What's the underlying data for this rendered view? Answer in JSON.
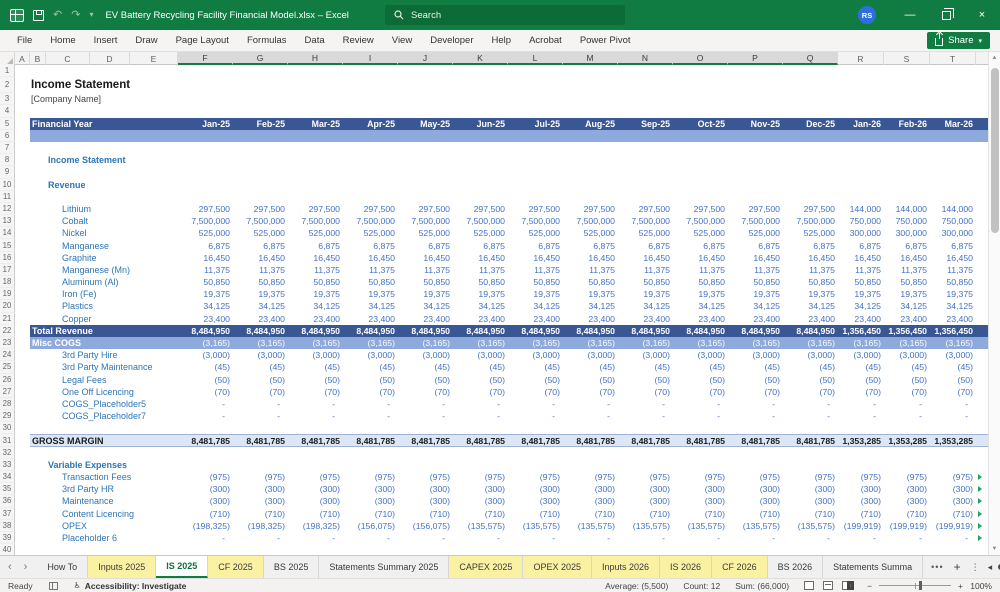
{
  "colors": {
    "titlebar_green": "#107C41",
    "search_green": "#0D6B37",
    "band_dark": "#3A5795",
    "band_light": "#8EA9DB",
    "gross_bg": "#DCE6F4",
    "label_blue": "#2E75B6",
    "value_blue": "#4472C4",
    "tab_yellow": "#FBF1A3",
    "avatar_blue": "#2D6FDF",
    "marker_green": "#21A366"
  },
  "icons": {
    "minimize": "—",
    "close": "×",
    "qat_dropdown": "▾",
    "undo": "↶",
    "redo": "↷",
    "share_dropdown": "▾",
    "tab_left": "‹",
    "tab_right": "›",
    "more_tabs": "•••",
    "add_sheet": "+",
    "sheet_list": "⋮",
    "hscroll_left": "◂",
    "hscroll_right": "▸",
    "vscroll_up": "▲",
    "vscroll_down": "▼",
    "zoom_out": "−",
    "zoom_in": "+",
    "accessibility": "♿"
  },
  "title_bar": {
    "title": "EV Battery Recycling Facility Financial Model.xlsx  –  Excel",
    "search_placeholder": "Search",
    "avatar_initials": "RS"
  },
  "ribbon": {
    "tabs": [
      "File",
      "Home",
      "Insert",
      "Draw",
      "Page Layout",
      "Formulas",
      "Data",
      "Review",
      "View",
      "Developer",
      "Help",
      "Acrobat",
      "Power Pivot"
    ],
    "share_label": "Share"
  },
  "grid": {
    "column_letters": [
      "A",
      "B",
      "C",
      "D",
      "E",
      "F",
      "G",
      "H",
      "I",
      "J",
      "K",
      "L",
      "M",
      "N",
      "O",
      "P",
      "Q",
      "R",
      "S",
      "T"
    ],
    "selected_column_range": [
      "F",
      "Q"
    ],
    "months": [
      "Jan-25",
      "Feb-25",
      "Mar-25",
      "Apr-25",
      "May-25",
      "Jun-25",
      "Jul-25",
      "Aug-25",
      "Sep-25",
      "Oct-25",
      "Nov-25",
      "Dec-25",
      "Jan-26",
      "Feb-26",
      "Mar-26"
    ],
    "rows": [
      {
        "n": 1,
        "type": "blank"
      },
      {
        "n": 2,
        "type": "doc-title",
        "label": "Income Statement"
      },
      {
        "n": 3,
        "type": "doc-subtitle",
        "label": "[Company Name]"
      },
      {
        "n": 4,
        "type": "blank"
      },
      {
        "n": 5,
        "type": "month-header",
        "label": "Financial Year"
      },
      {
        "n": 6,
        "type": "band"
      },
      {
        "n": 7,
        "type": "blank"
      },
      {
        "n": 8,
        "type": "section",
        "label": "Income Statement"
      },
      {
        "n": 9,
        "type": "blank"
      },
      {
        "n": 10,
        "type": "section",
        "label": "Revenue"
      },
      {
        "n": 11,
        "type": "blank"
      },
      {
        "n": 12,
        "type": "item",
        "label": "Lithium",
        "values": [
          "297,500",
          "297,500",
          "297,500",
          "297,500",
          "297,500",
          "297,500",
          "297,500",
          "297,500",
          "297,500",
          "297,500",
          "297,500",
          "297,500",
          "144,000",
          "144,000",
          "144,000"
        ]
      },
      {
        "n": 13,
        "type": "item",
        "label": "Cobalt",
        "values": [
          "7,500,000",
          "7,500,000",
          "7,500,000",
          "7,500,000",
          "7,500,000",
          "7,500,000",
          "7,500,000",
          "7,500,000",
          "7,500,000",
          "7,500,000",
          "7,500,000",
          "7,500,000",
          "750,000",
          "750,000",
          "750,000"
        ]
      },
      {
        "n": 14,
        "type": "item",
        "label": "Nickel",
        "values": [
          "525,000",
          "525,000",
          "525,000",
          "525,000",
          "525,000",
          "525,000",
          "525,000",
          "525,000",
          "525,000",
          "525,000",
          "525,000",
          "525,000",
          "300,000",
          "300,000",
          "300,000"
        ]
      },
      {
        "n": 15,
        "type": "item",
        "label": "Manganese",
        "values": [
          "6,875",
          "6,875",
          "6,875",
          "6,875",
          "6,875",
          "6,875",
          "6,875",
          "6,875",
          "6,875",
          "6,875",
          "6,875",
          "6,875",
          "6,875",
          "6,875",
          "6,875"
        ]
      },
      {
        "n": 16,
        "type": "item",
        "label": "Graphite",
        "values": [
          "16,450",
          "16,450",
          "16,450",
          "16,450",
          "16,450",
          "16,450",
          "16,450",
          "16,450",
          "16,450",
          "16,450",
          "16,450",
          "16,450",
          "16,450",
          "16,450",
          "16,450"
        ]
      },
      {
        "n": 17,
        "type": "item",
        "label": "Manganese (Mn)",
        "values": [
          "11,375",
          "11,375",
          "11,375",
          "11,375",
          "11,375",
          "11,375",
          "11,375",
          "11,375",
          "11,375",
          "11,375",
          "11,375",
          "11,375",
          "11,375",
          "11,375",
          "11,375"
        ]
      },
      {
        "n": 18,
        "type": "item",
        "label": "Aluminum (Al)",
        "values": [
          "50,850",
          "50,850",
          "50,850",
          "50,850",
          "50,850",
          "50,850",
          "50,850",
          "50,850",
          "50,850",
          "50,850",
          "50,850",
          "50,850",
          "50,850",
          "50,850",
          "50,850"
        ]
      },
      {
        "n": 19,
        "type": "item",
        "label": "Iron (Fe)",
        "values": [
          "19,375",
          "19,375",
          "19,375",
          "19,375",
          "19,375",
          "19,375",
          "19,375",
          "19,375",
          "19,375",
          "19,375",
          "19,375",
          "19,375",
          "19,375",
          "19,375",
          "19,375"
        ]
      },
      {
        "n": 20,
        "type": "item",
        "label": "Plastics",
        "values": [
          "34,125",
          "34,125",
          "34,125",
          "34,125",
          "34,125",
          "34,125",
          "34,125",
          "34,125",
          "34,125",
          "34,125",
          "34,125",
          "34,125",
          "34,125",
          "34,125",
          "34,125"
        ]
      },
      {
        "n": 21,
        "type": "item",
        "label": "Copper",
        "values": [
          "23,400",
          "23,400",
          "23,400",
          "23,400",
          "23,400",
          "23,400",
          "23,400",
          "23,400",
          "23,400",
          "23,400",
          "23,400",
          "23,400",
          "23,400",
          "23,400",
          "23,400"
        ]
      },
      {
        "n": 22,
        "type": "total",
        "label": "Total Revenue",
        "values": [
          "8,484,950",
          "8,484,950",
          "8,484,950",
          "8,484,950",
          "8,484,950",
          "8,484,950",
          "8,484,950",
          "8,484,950",
          "8,484,950",
          "8,484,950",
          "8,484,950",
          "8,484,950",
          "1,356,450",
          "1,356,450",
          "1,356,450"
        ]
      },
      {
        "n": 23,
        "type": "subtotal-band",
        "label": "Misc COGS",
        "values": [
          "(3,165)",
          "(3,165)",
          "(3,165)",
          "(3,165)",
          "(3,165)",
          "(3,165)",
          "(3,165)",
          "(3,165)",
          "(3,165)",
          "(3,165)",
          "(3,165)",
          "(3,165)",
          "(3,165)",
          "(3,165)",
          "(3,165)"
        ]
      },
      {
        "n": 24,
        "type": "item",
        "label": "3rd Party Hire",
        "values": [
          "(3,000)",
          "(3,000)",
          "(3,000)",
          "(3,000)",
          "(3,000)",
          "(3,000)",
          "(3,000)",
          "(3,000)",
          "(3,000)",
          "(3,000)",
          "(3,000)",
          "(3,000)",
          "(3,000)",
          "(3,000)",
          "(3,000)"
        ]
      },
      {
        "n": 25,
        "type": "item",
        "label": "3rd Party Maintenance",
        "values": [
          "(45)",
          "(45)",
          "(45)",
          "(45)",
          "(45)",
          "(45)",
          "(45)",
          "(45)",
          "(45)",
          "(45)",
          "(45)",
          "(45)",
          "(45)",
          "(45)",
          "(45)"
        ]
      },
      {
        "n": 26,
        "type": "item",
        "label": "Legal Fees",
        "values": [
          "(50)",
          "(50)",
          "(50)",
          "(50)",
          "(50)",
          "(50)",
          "(50)",
          "(50)",
          "(50)",
          "(50)",
          "(50)",
          "(50)",
          "(50)",
          "(50)",
          "(50)"
        ]
      },
      {
        "n": 27,
        "type": "item",
        "label": "One Off Licencing",
        "values": [
          "(70)",
          "(70)",
          "(70)",
          "(70)",
          "(70)",
          "(70)",
          "(70)",
          "(70)",
          "(70)",
          "(70)",
          "(70)",
          "(70)",
          "(70)",
          "(70)",
          "(70)"
        ]
      },
      {
        "n": 28,
        "type": "item",
        "label": "COGS_Placeholder5",
        "values": [
          "-",
          "-",
          "-",
          "-",
          "-",
          "-",
          "-",
          "-",
          "-",
          "-",
          "-",
          "-",
          "-",
          "-",
          "-"
        ]
      },
      {
        "n": 29,
        "type": "item",
        "label": "COGS_Placeholder7",
        "values": [
          "-",
          "-",
          "-",
          "-",
          "-",
          "-",
          "-",
          "-",
          "-",
          "-",
          "-",
          "-",
          "-",
          "-",
          "-"
        ]
      },
      {
        "n": 30,
        "type": "blank"
      },
      {
        "n": 31,
        "type": "grossmargin",
        "label": "GROSS MARGIN",
        "values": [
          "8,481,785",
          "8,481,785",
          "8,481,785",
          "8,481,785",
          "8,481,785",
          "8,481,785",
          "8,481,785",
          "8,481,785",
          "8,481,785",
          "8,481,785",
          "8,481,785",
          "8,481,785",
          "1,353,285",
          "1,353,285",
          "1,353,285"
        ]
      },
      {
        "n": 32,
        "type": "blank"
      },
      {
        "n": 33,
        "type": "section",
        "label": "Variable Expenses"
      },
      {
        "n": 34,
        "type": "item",
        "label": "Transaction Fees",
        "marker": true,
        "values": [
          "(975)",
          "(975)",
          "(975)",
          "(975)",
          "(975)",
          "(975)",
          "(975)",
          "(975)",
          "(975)",
          "(975)",
          "(975)",
          "(975)",
          "(975)",
          "(975)",
          "(975)"
        ]
      },
      {
        "n": 35,
        "type": "item",
        "label": "3rd Party HR",
        "marker": true,
        "values": [
          "(300)",
          "(300)",
          "(300)",
          "(300)",
          "(300)",
          "(300)",
          "(300)",
          "(300)",
          "(300)",
          "(300)",
          "(300)",
          "(300)",
          "(300)",
          "(300)",
          "(300)"
        ]
      },
      {
        "n": 36,
        "type": "item",
        "label": "Maintenance",
        "marker": true,
        "values": [
          "(300)",
          "(300)",
          "(300)",
          "(300)",
          "(300)",
          "(300)",
          "(300)",
          "(300)",
          "(300)",
          "(300)",
          "(300)",
          "(300)",
          "(300)",
          "(300)",
          "(300)"
        ]
      },
      {
        "n": 37,
        "type": "item",
        "label": "Content Licencing",
        "marker": true,
        "values": [
          "(710)",
          "(710)",
          "(710)",
          "(710)",
          "(710)",
          "(710)",
          "(710)",
          "(710)",
          "(710)",
          "(710)",
          "(710)",
          "(710)",
          "(710)",
          "(710)",
          "(710)"
        ]
      },
      {
        "n": 38,
        "type": "item",
        "label": "OPEX",
        "marker": true,
        "values": [
          "(198,325)",
          "(198,325)",
          "(198,325)",
          "(156,075)",
          "(156,075)",
          "(135,575)",
          "(135,575)",
          "(135,575)",
          "(135,575)",
          "(135,575)",
          "(135,575)",
          "(135,575)",
          "(199,919)",
          "(199,919)",
          "(199,919)"
        ]
      },
      {
        "n": 39,
        "type": "item",
        "label": "Placeholder 6",
        "marker": true,
        "values": [
          "-",
          "-",
          "-",
          "-",
          "-",
          "-",
          "-",
          "-",
          "-",
          "-",
          "-",
          "-",
          "-",
          "-",
          "-"
        ]
      },
      {
        "n": 40,
        "type": "blank"
      }
    ]
  },
  "sheet_tabs": {
    "tabs": [
      {
        "label": "How To",
        "style": "plain"
      },
      {
        "label": "Inputs 2025",
        "style": "yellow"
      },
      {
        "label": "IS 2025",
        "style": "active"
      },
      {
        "label": "CF 2025",
        "style": "yellow"
      },
      {
        "label": "BS 2025",
        "style": "plain"
      },
      {
        "label": "Statements Summary 2025",
        "style": "plain"
      },
      {
        "label": "CAPEX 2025",
        "style": "yellow"
      },
      {
        "label": "OPEX 2025",
        "style": "yellow"
      },
      {
        "label": "Inputs 2026",
        "style": "yellow"
      },
      {
        "label": "IS 2026",
        "style": "yellow"
      },
      {
        "label": "CF 2026",
        "style": "yellow"
      },
      {
        "label": "BS 2026",
        "style": "plain"
      },
      {
        "label": "Statements Summa",
        "style": "plain"
      }
    ]
  },
  "status_bar": {
    "mode": "Ready",
    "accessibility": "Accessibility: Investigate",
    "average": "Average: (5,500)",
    "count": "Count: 12",
    "sum": "Sum: (66,000)",
    "zoom": "100%"
  }
}
